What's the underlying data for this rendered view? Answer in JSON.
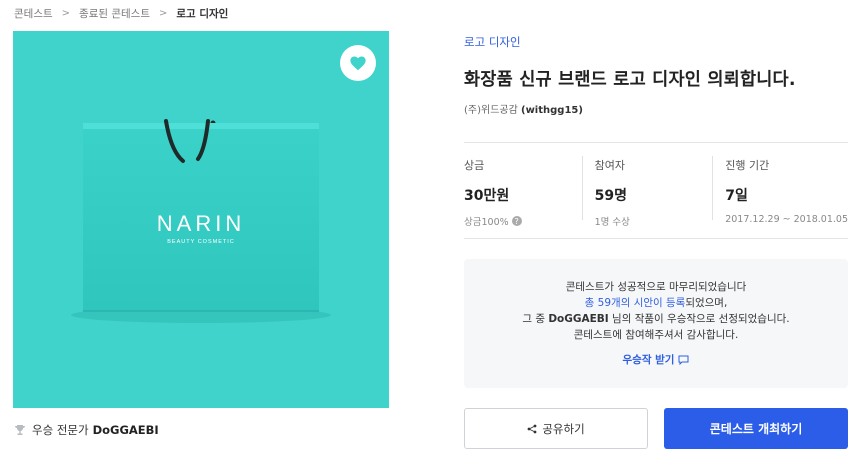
{
  "breadcrumb": {
    "items": [
      "콘테스트",
      "종료된 콘테스트",
      "로고 디자인"
    ]
  },
  "hero": {
    "brand": "NARIN",
    "brand_sub": "BEAUTY COSMETIC",
    "bg_color": "#3fd3cb",
    "favorite_icon": "heart-icon"
  },
  "winner": {
    "label": "우승 전문가",
    "name": "DoGGAEBI",
    "icon": "trophy-icon"
  },
  "contest": {
    "category": "로고 디자인",
    "title": "화장품 신규 브랜드 로고 디자인 의뢰합니다.",
    "host_company": "(주)위드공감",
    "host_id": "(withgg15)"
  },
  "stats": {
    "prize": {
      "label": "상금",
      "value": "30만원",
      "sub": "상금100%"
    },
    "participants": {
      "label": "참여자",
      "value": "59명",
      "sub": "1명 수상"
    },
    "period": {
      "label": "진행 기간",
      "value": "7일",
      "sub": "2017.12.29 ~ 2018.01.05"
    }
  },
  "notice": {
    "line1": "콘테스트가 성공적으로 마무리되었습니다",
    "line2_link": "총 59개의 시안이 등록",
    "line2_rest": "되었으며,",
    "line3_pre": "그 중 ",
    "line3_nick": "DoGGAEBI",
    "line3_post": " 님의 작품이 우승작으로 선정되었습니다.",
    "line4": "콘테스트에 참여해주셔서 감사합니다.",
    "award_link": "우승작 받기"
  },
  "actions": {
    "share_label": "공유하기",
    "host_label": "콘테스트 개최하기"
  },
  "colors": {
    "accent": "#2b5de8",
    "link": "#2f5fe0"
  }
}
